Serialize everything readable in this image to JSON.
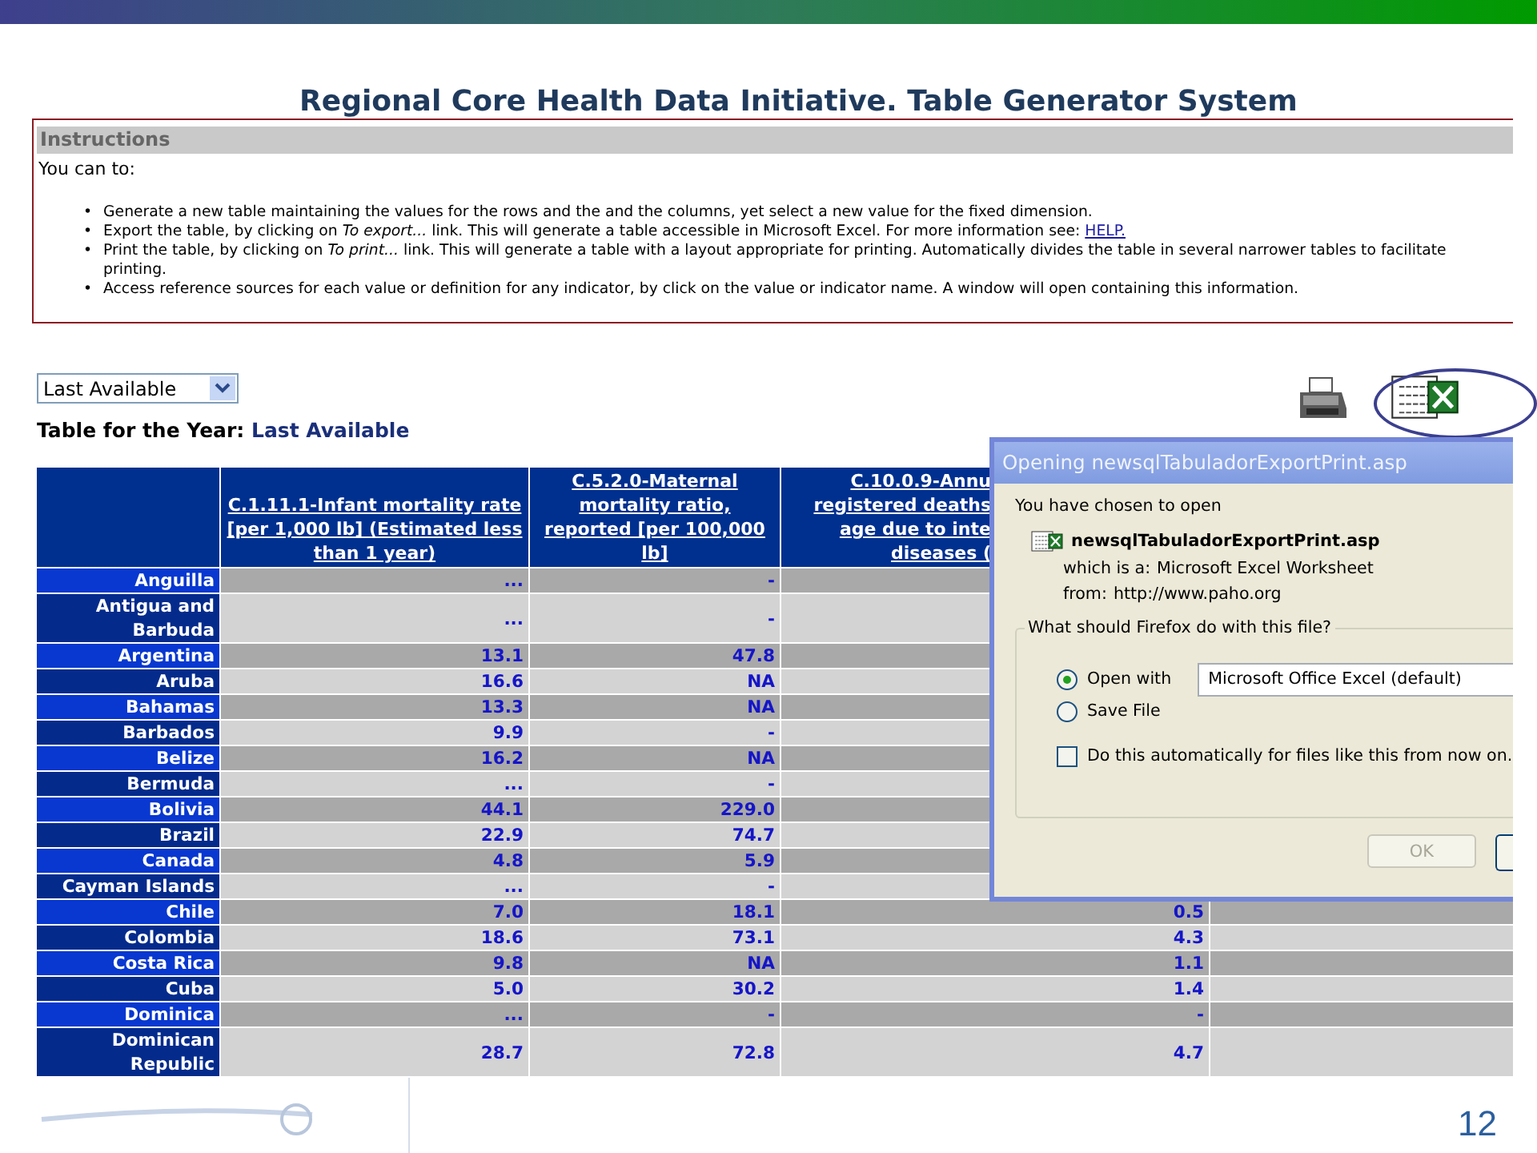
{
  "slide_title": "Regional Core Health Data Initiative. Table Generator System",
  "instructions": {
    "heading": "Instructions",
    "intro": "You can to:",
    "items": [
      {
        "marker": "•",
        "text": "Generate a new table maintaining the values for the rows and the and the columns, yet select a new value for the fixed dimension."
      },
      {
        "marker": "•",
        "text": "Export the table, by clicking on *To export...* link. This will generate a table accessible in Microsoft Excel. For more information see:",
        "link": "HELP."
      },
      {
        "marker": "•",
        "text": "Print the table, by clicking on *To print...* link. This will generate a table with a layout appropriate for printing. Automatically divides the table in several narrower tables to facilitate printing."
      },
      {
        "marker": "•",
        "text": "Access reference sources for each value or definition for any indicator, by click on the value or indicator name. A window will open containing this information."
      }
    ]
  },
  "year_select": {
    "value": "Last Available"
  },
  "table_caption": {
    "label": "Table for the Year:",
    "value": "Last Available"
  },
  "table": {
    "columns": [
      {
        "label": "C.1.11.1-Infant mortality rate [per 1,000 lb] (Estimated less than 1 year)"
      },
      {
        "label": "C.5.2.0-Maternal mortality ratio, reported [per 100,000 lb]"
      },
      {
        "label_lines": [
          "C.10.0.9-Annu",
          "registered deaths",
          "age due to inte",
          "diseases ("
        ]
      }
    ],
    "rows": [
      {
        "country": "Anguilla",
        "values": [
          "...",
          "-"
        ]
      },
      {
        "country": "Antigua and Barbuda",
        "values": [
          "...",
          "-"
        ]
      },
      {
        "country": "Argentina",
        "values": [
          "13.1",
          "47.8"
        ]
      },
      {
        "country": "Aruba",
        "values": [
          "16.6",
          "NA"
        ]
      },
      {
        "country": "Bahamas",
        "values": [
          "13.3",
          "NA"
        ]
      },
      {
        "country": "Barbados",
        "values": [
          "9.9",
          "-"
        ]
      },
      {
        "country": "Belize",
        "values": [
          "16.2",
          "NA"
        ]
      },
      {
        "country": "Bermuda",
        "values": [
          "...",
          "-"
        ]
      },
      {
        "country": "Bolivia",
        "values": [
          "44.1",
          "229.0"
        ]
      },
      {
        "country": "Brazil",
        "values": [
          "22.9",
          "74.7"
        ]
      },
      {
        "country": "Canada",
        "values": [
          "4.8",
          "5.9"
        ]
      },
      {
        "country": "Cayman Islands",
        "values": [
          "...",
          "-"
        ]
      },
      {
        "country": "Chile",
        "values": [
          "7.0",
          "18.1",
          "0.5"
        ]
      },
      {
        "country": "Colombia",
        "values": [
          "18.6",
          "73.1",
          "4.3"
        ]
      },
      {
        "country": "Costa Rica",
        "values": [
          "9.8",
          "NA",
          "1.1"
        ]
      },
      {
        "country": "Cuba",
        "values": [
          "5.0",
          "30.2",
          "1.4"
        ]
      },
      {
        "country": "Dominica",
        "values": [
          "...",
          "-",
          "-"
        ]
      },
      {
        "country": "Dominican Republic",
        "values": [
          "28.7",
          "72.8",
          "4.7"
        ]
      }
    ]
  },
  "dialog": {
    "title": "Opening newsqlTabuladorExportPrint.asp",
    "intro": "You have chosen to open",
    "file_name": "newsqlTabuladorExportPrint.asp",
    "details": [
      {
        "label": "which is a:",
        "value": "Microsoft Excel Worksheet"
      },
      {
        "label": "from:",
        "value": "http://www.paho.org"
      }
    ],
    "question": "What should Firefox do with this file?",
    "options": [
      {
        "label": "Open with",
        "selected": true,
        "app": "Microsoft Office Excel (default)"
      },
      {
        "label": "Save File",
        "selected": false
      }
    ],
    "auto_checkbox": {
      "label": "Do this automatically for files like this from now on.",
      "checked": false
    },
    "buttons": [
      {
        "label": "OK",
        "disabled": true
      }
    ]
  },
  "page_number": "12"
}
